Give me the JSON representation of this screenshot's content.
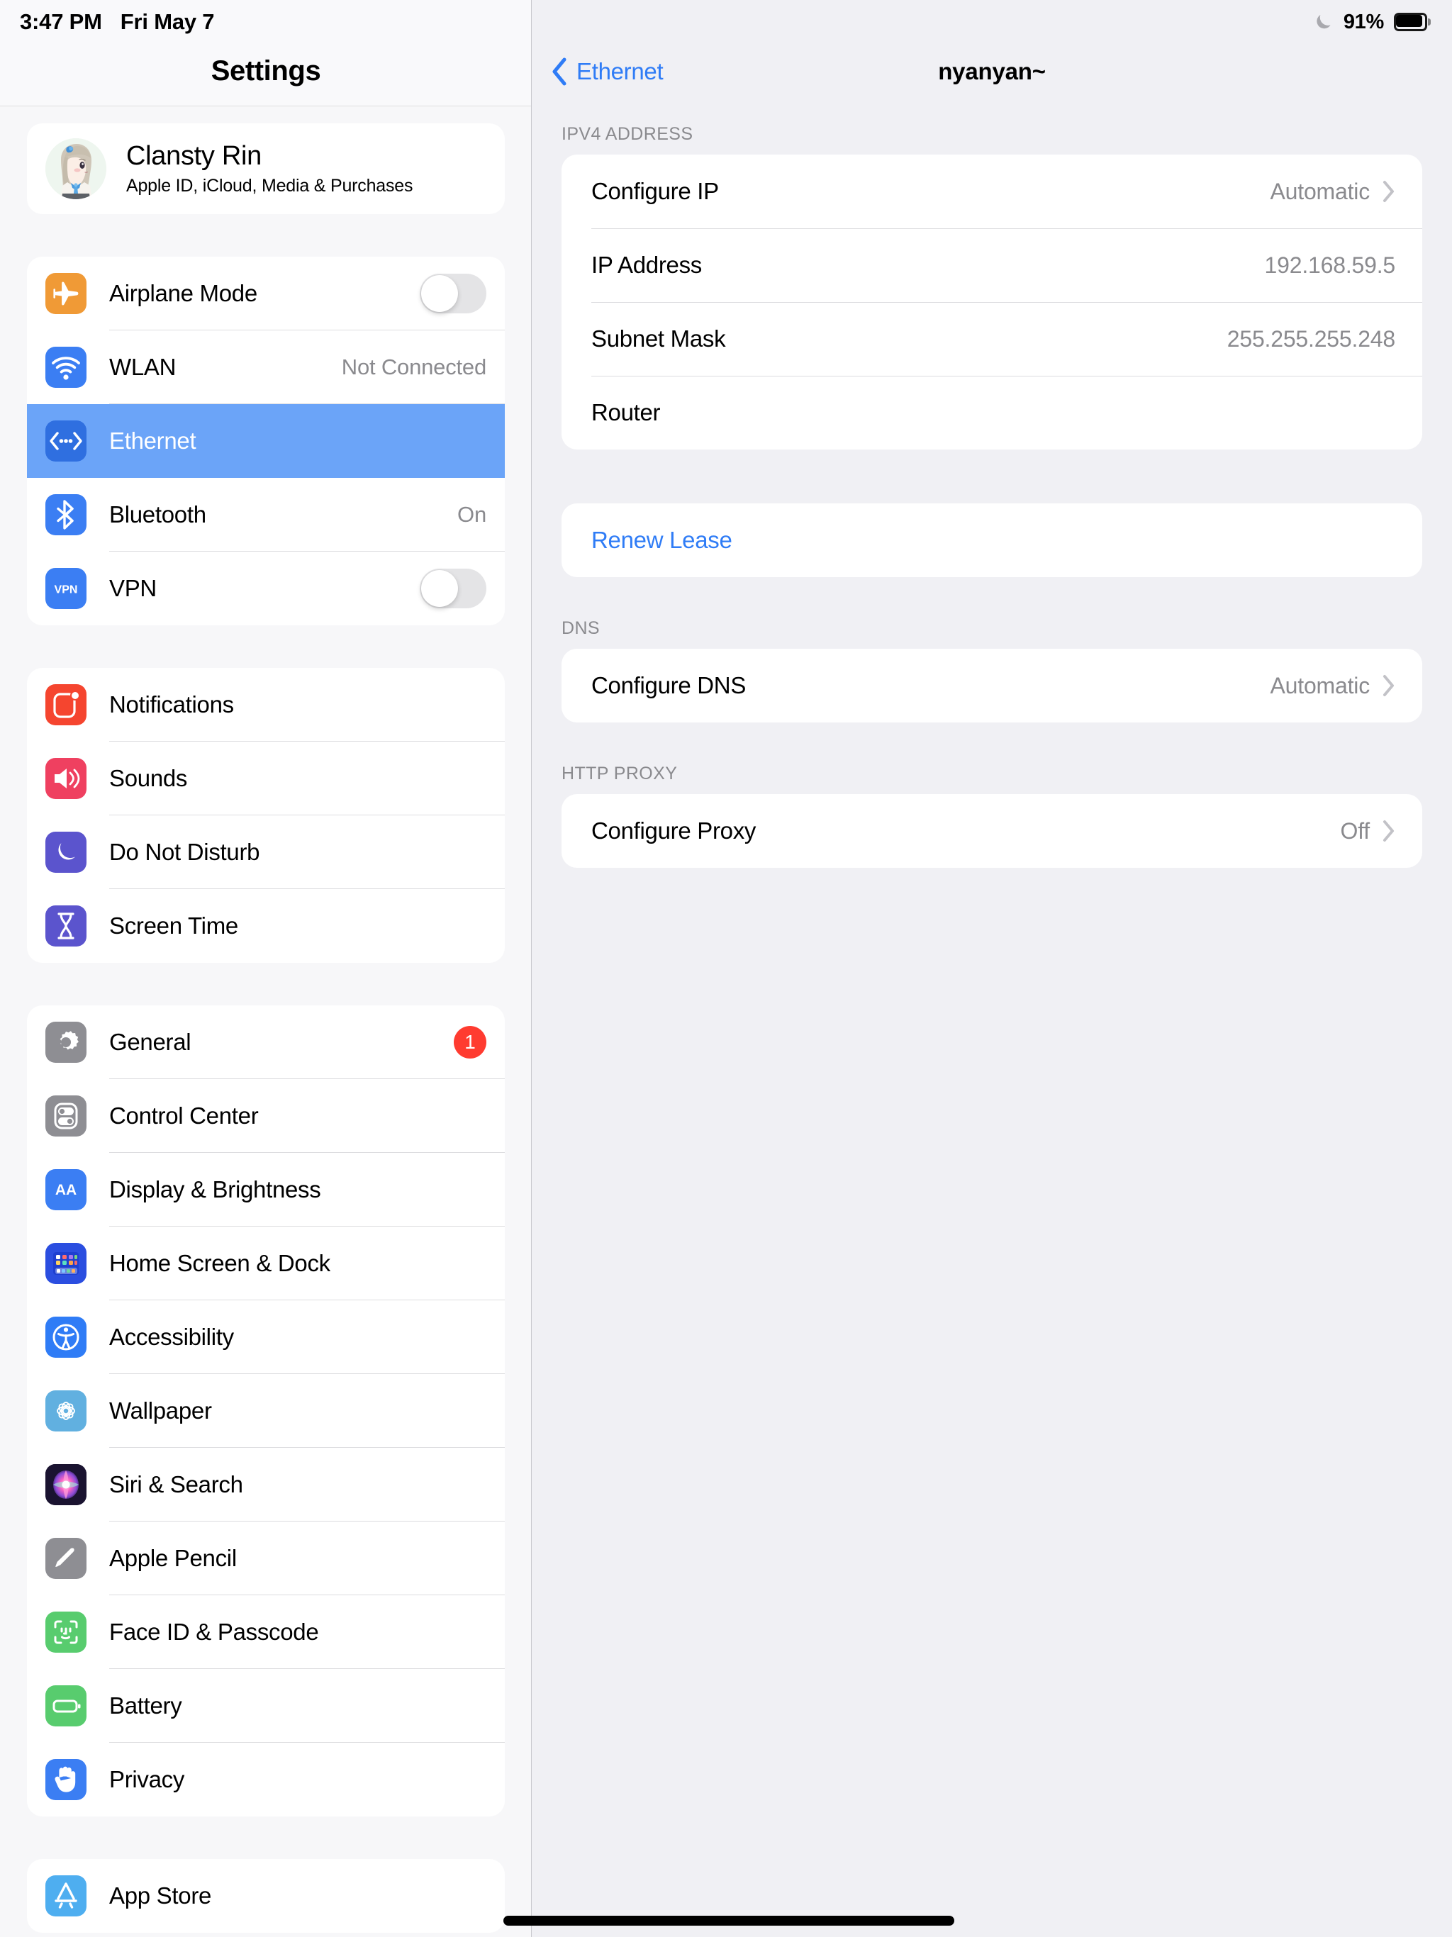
{
  "status_bar": {
    "time": "3:47 PM",
    "date": "Fri May 7",
    "dnd_icon": "moon-icon",
    "battery_percent": "91%",
    "battery_level": 91,
    "battery_icon": "battery-icon"
  },
  "sidebar": {
    "title": "Settings",
    "profile": {
      "name": "Clansty Rin",
      "subtitle": "Apple ID, iCloud, Media & Purchases",
      "avatar_icon": "avatar"
    },
    "groups": [
      {
        "id": "connectivity",
        "items": [
          {
            "label": "Airplane Mode",
            "icon": "airplane-icon",
            "icon_bg": "#f09a36",
            "control": "toggle",
            "toggle_on": false
          },
          {
            "label": "WLAN",
            "icon": "wifi-icon",
            "icon_bg": "#3b7ef3",
            "value": "Not Connected"
          },
          {
            "label": "Ethernet",
            "icon": "ethernet-icon",
            "icon_bg": "#2f6fe0",
            "selected": true
          },
          {
            "label": "Bluetooth",
            "icon": "bluetooth-icon",
            "icon_bg": "#3b7ef3",
            "value": "On"
          },
          {
            "label": "VPN",
            "icon": "vpn-icon",
            "icon_bg": "#3b7ef3",
            "control": "toggle",
            "toggle_on": false
          }
        ]
      },
      {
        "id": "alerts",
        "items": [
          {
            "label": "Notifications",
            "icon": "notifications-icon",
            "icon_bg": "#f5452f"
          },
          {
            "label": "Sounds",
            "icon": "sounds-icon",
            "icon_bg": "#ef4060"
          },
          {
            "label": "Do Not Disturb",
            "icon": "do-not-disturb-icon",
            "icon_bg": "#5b54cd"
          },
          {
            "label": "Screen Time",
            "icon": "screen-time-icon",
            "icon_bg": "#5b54cd"
          }
        ]
      },
      {
        "id": "system",
        "items": [
          {
            "label": "General",
            "icon": "gear-icon",
            "icon_bg": "#8e8e93",
            "badge": "1"
          },
          {
            "label": "Control Center",
            "icon": "control-center-icon",
            "icon_bg": "#8e8e93"
          },
          {
            "label": "Display & Brightness",
            "icon": "display-brightness-icon",
            "icon_bg": "#3b7ef3"
          },
          {
            "label": "Home Screen & Dock",
            "icon": "home-screen-dock-icon",
            "icon_bg": "#2b4ee0"
          },
          {
            "label": "Accessibility",
            "icon": "accessibility-icon",
            "icon_bg": "#2f7cf6"
          },
          {
            "label": "Wallpaper",
            "icon": "wallpaper-icon",
            "icon_bg": "#61b0e0"
          },
          {
            "label": "Siri & Search",
            "icon": "siri-icon",
            "icon_bg": "#1a1330"
          },
          {
            "label": "Apple Pencil",
            "icon": "apple-pencil-icon",
            "icon_bg": "#8e8e93"
          },
          {
            "label": "Face ID & Passcode",
            "icon": "face-id-icon",
            "icon_bg": "#58cc6e"
          },
          {
            "label": "Battery",
            "icon": "battery-settings-icon",
            "icon_bg": "#58cc6e"
          },
          {
            "label": "Privacy",
            "icon": "privacy-icon",
            "icon_bg": "#3b7ef3"
          }
        ]
      },
      {
        "id": "stores",
        "items": [
          {
            "label": "App Store",
            "icon": "app-store-icon",
            "icon_bg": "#4eaef0"
          }
        ]
      }
    ]
  },
  "detail": {
    "back_label": "Ethernet",
    "back_icon": "chevron-left-icon",
    "title": "nyanyan~",
    "sections": [
      {
        "header": "IPv4 Address",
        "rows": [
          {
            "label": "Configure IP",
            "value": "Automatic",
            "chevron": true
          },
          {
            "label": "IP Address",
            "value": "192.168.59.5",
            "chevron": false
          },
          {
            "label": "Subnet Mask",
            "value": "255.255.255.248",
            "chevron": false
          },
          {
            "label": "Router",
            "value": "",
            "chevron": false
          }
        ]
      },
      {
        "header": "",
        "rows": [
          {
            "label": "Renew Lease",
            "value": "",
            "chevron": false,
            "link": true
          }
        ]
      },
      {
        "header": "DNS",
        "rows": [
          {
            "label": "Configure DNS",
            "value": "Automatic",
            "chevron": true
          }
        ]
      },
      {
        "header": "HTTP Proxy",
        "rows": [
          {
            "label": "Configure Proxy",
            "value": "Off",
            "chevron": true
          }
        ]
      }
    ]
  },
  "colors": {
    "accent_blue": "#2f7cf6",
    "selection_blue": "#6ba4f8",
    "badge_red": "#ff3b30",
    "card_white": "#ffffff",
    "page_bg": "#f0f0f4",
    "sidebar_bg": "#f7f7f9",
    "secondary_text": "#8a8a8e"
  },
  "home_indicator": "home-indicator"
}
